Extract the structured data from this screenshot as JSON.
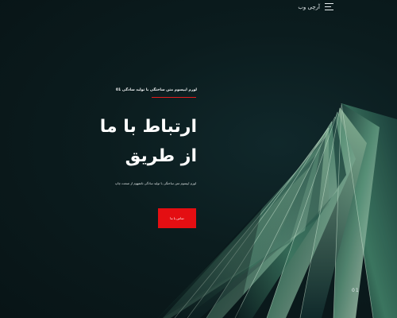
{
  "header": {
    "brand": "آرچی وب",
    "menu_icon": "menu-icon"
  },
  "hero": {
    "kicker": "لورم ایپسوم متن ساختگی با تولید سادگی 01",
    "title_line1": "ارتباط با ما",
    "title_line2": "از طریق",
    "description": "لورم ایپسوم متن ساختگی با تولید سادگی نامفهوم از صنعت چاپ",
    "cta_label": "تماس با ما"
  },
  "slider": {
    "indicator": "01"
  },
  "colors": {
    "accent": "#e40e12",
    "background": "#0b1a1c"
  }
}
